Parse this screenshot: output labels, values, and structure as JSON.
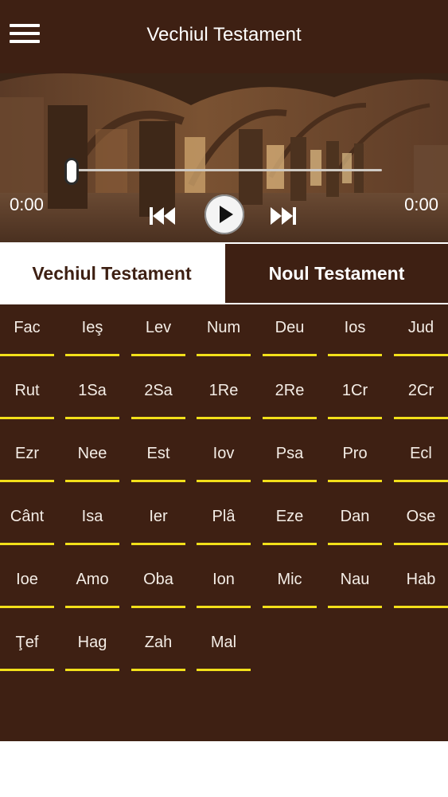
{
  "header": {
    "title": "Vechiul Testament",
    "menu_icon": "hamburger-menu-icon"
  },
  "player": {
    "time_elapsed": "0:00",
    "time_total": "0:00",
    "progress": 0,
    "controls": [
      "previous-track-icon",
      "play-icon",
      "next-track-icon"
    ]
  },
  "tabs": {
    "old": "Vechiul Testament",
    "new": "Noul Testament",
    "selected": "old"
  },
  "books": [
    "Fac",
    "Ieş",
    "Lev",
    "Num",
    "Deu",
    "Ios",
    "Jud",
    "Rut",
    "1Sa",
    "2Sa",
    "1Re",
    "2Re",
    "1Cr",
    "2Cr",
    "Ezr",
    "Nee",
    "Est",
    "Iov",
    "Psa",
    "Pro",
    "Ecl",
    "Cânt",
    "Isa",
    "Ier",
    "Plâ",
    "Eze",
    "Dan",
    "Ose",
    "Ioe",
    "Amo",
    "Oba",
    "Ion",
    "Mic",
    "Nau",
    "Hab",
    "Ţef",
    "Hag",
    "Zah",
    "Mal"
  ],
  "colors": {
    "brown": "#3e2013",
    "accent_yellow": "#f2df1a",
    "white": "#ffffff"
  }
}
